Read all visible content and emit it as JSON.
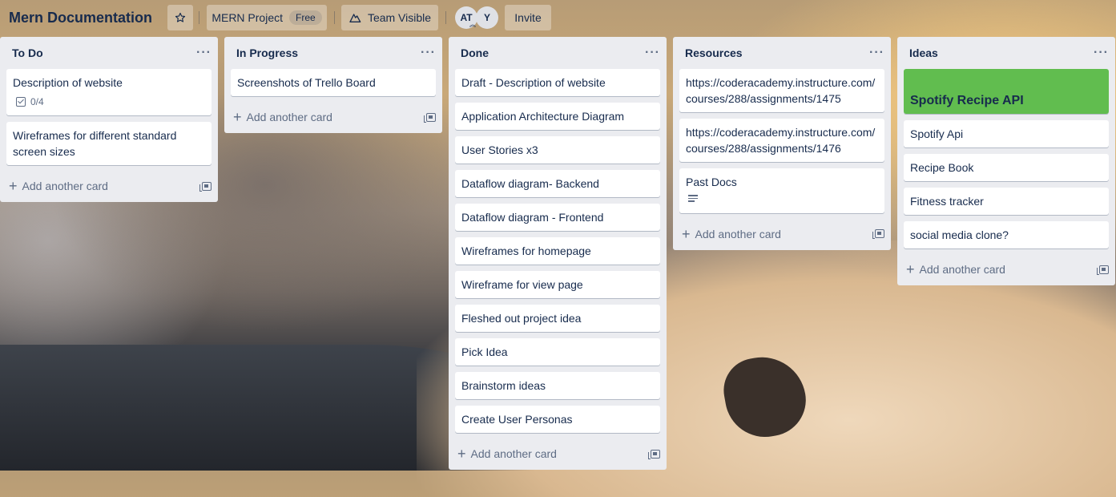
{
  "header": {
    "board_title": "Mern Documentation",
    "star_icon": "star-icon",
    "workspace_label": "MERN Project",
    "workspace_badge": "Free",
    "visibility_label": "Team Visible",
    "members": [
      {
        "initials": "AT"
      },
      {
        "initials": "Y"
      }
    ],
    "invite_label": "Invite"
  },
  "lists": [
    {
      "title": "To Do",
      "cards": [
        {
          "title": "Description of website",
          "checklist": "0/4"
        },
        {
          "title": "Wireframes for different standard screen sizes"
        }
      ],
      "add_label": "Add another card"
    },
    {
      "title": "In Progress",
      "cards": [
        {
          "title": "Screenshots of Trello Board"
        }
      ],
      "add_label": "Add another card"
    },
    {
      "title": "Done",
      "cards": [
        {
          "title": "Draft - Description of website"
        },
        {
          "title": "Application Architecture Diagram"
        },
        {
          "title": "User Stories x3"
        },
        {
          "title": "Dataflow diagram- Backend"
        },
        {
          "title": "Dataflow diagram - Frontend"
        },
        {
          "title": "Wireframes for homepage"
        },
        {
          "title": "Wireframe for view page"
        },
        {
          "title": "Fleshed out project idea"
        },
        {
          "title": "Pick Idea"
        },
        {
          "title": "Brainstorm ideas"
        },
        {
          "title": "Create User Personas"
        }
      ],
      "add_label": "Add another card"
    },
    {
      "title": "Resources",
      "cards": [
        {
          "title": "https://coderacademy.instructure.com/courses/288/assignments/1475"
        },
        {
          "title": "https://coderacademy.instructure.com/courses/288/assignments/1476"
        },
        {
          "title": "Past Docs"
        }
      ],
      "add_label": "Add another card"
    },
    {
      "title": "Ideas",
      "cards": [
        {
          "title": "Spotify Recipe API",
          "cover_color": "#61bd4f"
        },
        {
          "title": "Spotify Api"
        },
        {
          "title": "Recipe Book"
        },
        {
          "title": "Fitness tracker"
        },
        {
          "title": "social media clone?"
        }
      ],
      "add_label": "Add another card"
    }
  ],
  "colors": {
    "list_bg": "#ebecf0",
    "card_bg": "#ffffff",
    "label_green": "#61bd4f",
    "text": "#172b4d",
    "muted": "#5e6c84"
  }
}
